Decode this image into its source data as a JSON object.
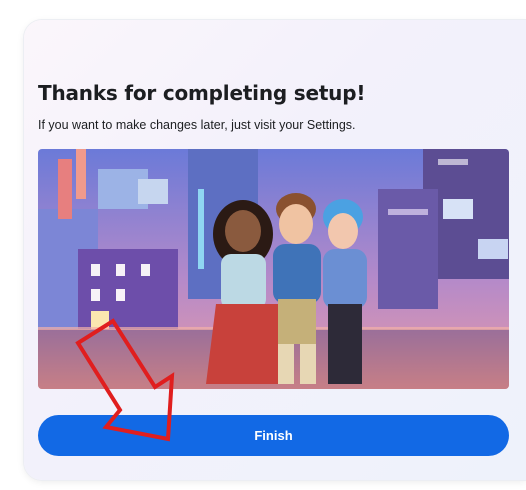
{
  "dialog": {
    "title": "Thanks for completing setup!",
    "subtitle": "If you want to make changes later, just visit your Settings.",
    "finish_label": "Finish"
  },
  "colors": {
    "accent": "#1269e5",
    "annotation_arrow": "#e01e1e"
  },
  "annotation": {
    "type": "arrow",
    "points_to": "finish-button"
  }
}
